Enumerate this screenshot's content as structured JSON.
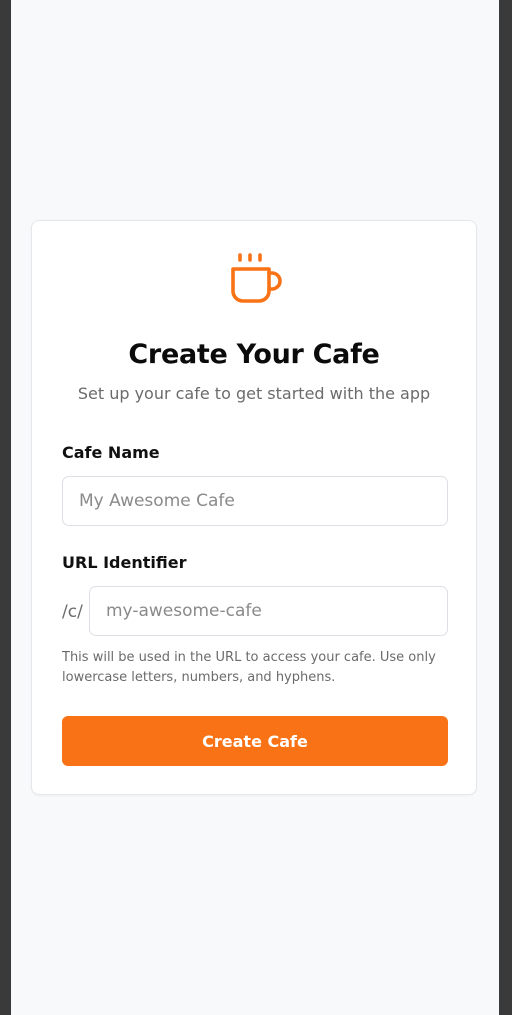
{
  "header": {
    "icon": "coffee-cup-icon",
    "title": "Create Your Cafe",
    "subtitle": "Set up your cafe to get started with the app"
  },
  "form": {
    "cafe_name": {
      "label": "Cafe Name",
      "value": "",
      "placeholder": "My Awesome Cafe"
    },
    "url_identifier": {
      "label": "URL Identifier",
      "prefix": "/c/",
      "value": "",
      "placeholder": "my-awesome-cafe",
      "helper": "This will be used in the URL to access your cafe. Use only lowercase letters, numbers, and hyphens."
    },
    "submit_label": "Create Cafe"
  },
  "colors": {
    "accent": "#f97316",
    "background": "#f8f9fa",
    "card": "#ffffff"
  }
}
